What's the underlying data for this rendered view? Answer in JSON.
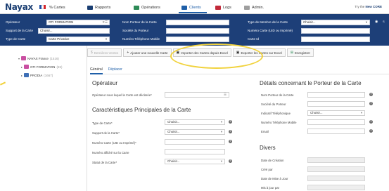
{
  "app": {
    "logo": "Nayax",
    "flag_colors": [
      "#1f4ea3",
      "#ffffff",
      "#d6232a"
    ],
    "brand_right_prefix": "Try the",
    "brand_right_name": "New CORE"
  },
  "nav": {
    "items": [
      {
        "label": "% Cartes",
        "icon": "card-icon",
        "color": "#9e9e9e"
      },
      {
        "label": "Rapports",
        "icon": "report-icon",
        "color": "#1a3e72"
      },
      {
        "label": "Opérations",
        "icon": "operations-icon",
        "color": "#2e8b57"
      },
      {
        "label": "Clients",
        "icon": "clients-icon",
        "color": "#1f5fa8",
        "active": true
      },
      {
        "label": "Logs",
        "icon": "logs-icon",
        "color": "#c22a3a"
      },
      {
        "label": "Admin.",
        "icon": "admin-icon",
        "color": "#9e9e9e"
      }
    ]
  },
  "filters": {
    "operator_label": "Opérateur",
    "operator_value": "OTI FORMATION",
    "support_label": "Support de la Carte",
    "support_value": "Choisir...",
    "type_label": "Type de Carte",
    "type_value": "Carte Privative",
    "holder_name_label": "Nom Porteur de la Carte",
    "holder_company_label": "Société du Porteur",
    "holder_phone_label": "Numéro Téléphone Mobile",
    "member_type_label": "Type de Membre de la Carte",
    "member_type_value": "Choisir...",
    "card_number_label": "Numéro Carte (UID ou Imprimé)",
    "card_id_label": "Carte Id"
  },
  "tree": {
    "items": [
      {
        "label": "NAYAX France",
        "suffix": "(1516)"
      },
      {
        "label": "OTI FORMATION",
        "suffix": "(65)"
      },
      {
        "label": "PRODIA",
        "suffix": "(1667)"
      }
    ]
  },
  "toolbar": {
    "recent": "Dernières Ventes",
    "add": "Ajouter une nouvelle Carte",
    "import": "Importer des Cartes depuis Excel",
    "export": "Exporter les Cartes sur Excel",
    "save": "Enregistrer"
  },
  "tabs": {
    "general": "Général",
    "move": "Déplacer"
  },
  "form": {
    "operator_section": "Opérateur",
    "operator_field": "Opérateur sous lequel la Carte est déclarée*",
    "main_section": "Caractéristiques Principales de la Carte",
    "card_type": "Type de Carte*",
    "card_support": "Support de la Carte*",
    "card_number": "Numéro Carte (UID ou Imprimé)*",
    "card_printed": "Numéro affiché sur la Carte",
    "card_status": "Statut de la Carte*",
    "choose": "Choisir..."
  },
  "holder": {
    "section": "Détails concernant le Porteur de la Carte",
    "name": "Nom Porteur de la Carte",
    "company": "Société du Porteur",
    "phone_prefix": "Indicatif Téléphonique",
    "phone_prefix_value": "Choisir...",
    "mobile": "Numéro Téléphone Mobile",
    "email": "Email"
  },
  "misc": {
    "section": "Divers",
    "created": "Date de Création",
    "created_by": "Créé par",
    "updated": "Date de Mise à Jour",
    "updated_by": "Mis à jour par"
  },
  "colors": {
    "nav_blue": "#1d3f78",
    "accent": "#1f5fa8",
    "highlight": "#f1d23c"
  }
}
